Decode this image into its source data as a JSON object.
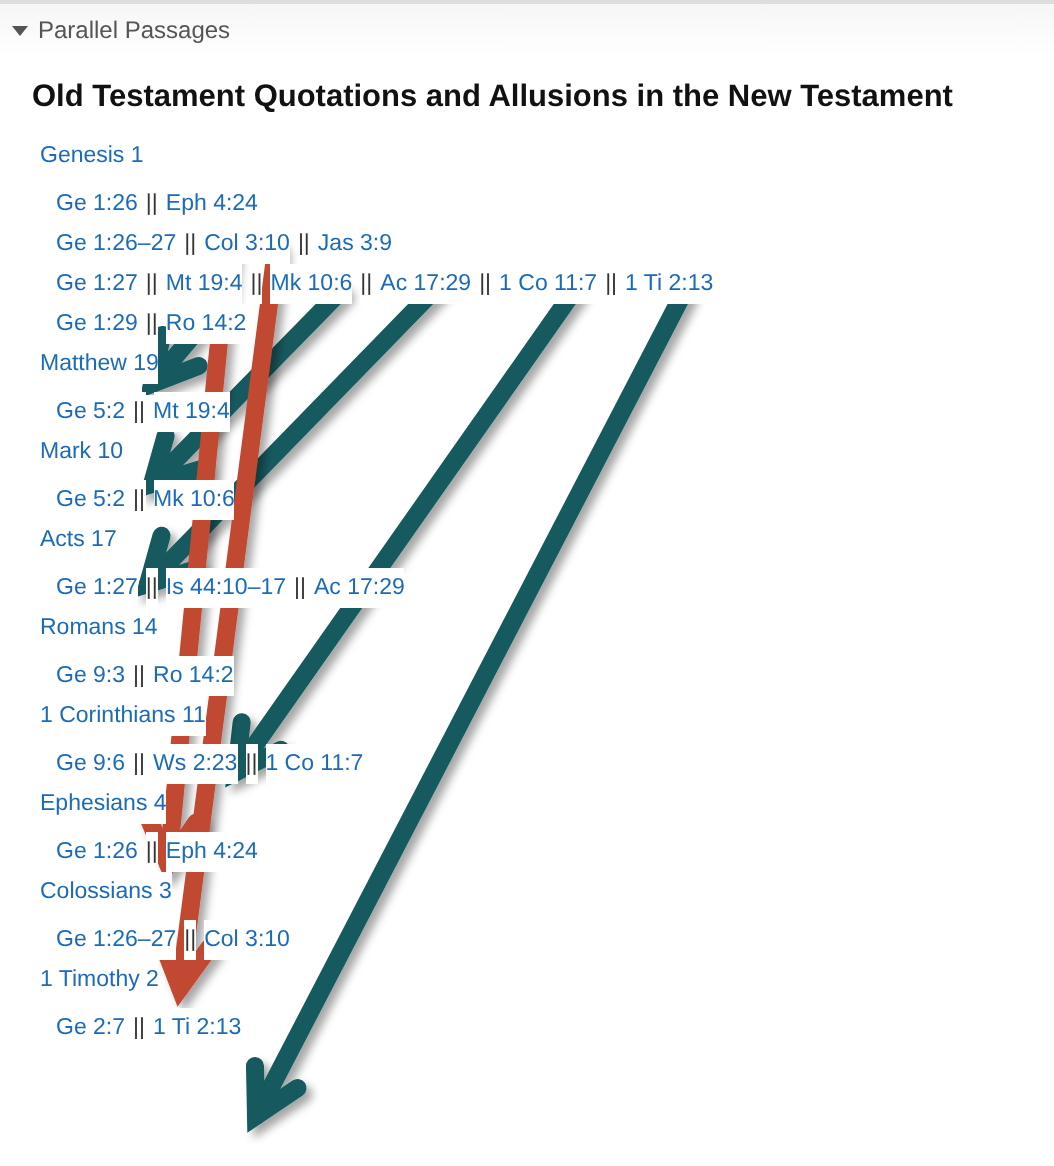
{
  "panel": {
    "title": "Parallel Passages",
    "expanded": true
  },
  "heading": "Old Testament Quotations and Allusions in the New Testament",
  "sections": [
    {
      "title": "Genesis 1",
      "passages": [
        {
          "refs": [
            "Ge 1:26",
            "Eph 4:24"
          ]
        },
        {
          "refs": [
            "Ge 1:26–27",
            "Col 3:10",
            "Jas 3:9"
          ]
        },
        {
          "refs": [
            "Ge 1:27",
            "Mt 19:4",
            "Mk 10:6",
            "Ac 17:29",
            "1 Co 11:7",
            "1 Ti 2:13"
          ]
        },
        {
          "refs": [
            "Ge 1:29",
            "Ro 14:2"
          ]
        }
      ]
    },
    {
      "title": "Matthew 19",
      "passages": [
        {
          "refs": [
            "Ge 5:2",
            "Mt 19:4"
          ]
        }
      ]
    },
    {
      "title": "Mark 10",
      "passages": [
        {
          "refs": [
            "Ge 5:2",
            "Mk 10:6"
          ]
        }
      ]
    },
    {
      "title": "Acts 17",
      "passages": [
        {
          "refs": [
            "Ge 1:27",
            "Is 44:10–17",
            "Ac 17:29"
          ]
        }
      ]
    },
    {
      "title": "Romans 14",
      "passages": [
        {
          "refs": [
            "Ge 9:3",
            "Ro 14:2"
          ]
        }
      ]
    },
    {
      "title": "1 Corinthians 11",
      "passages": [
        {
          "refs": [
            "Ge 9:6",
            "Ws 2:23",
            "1 Co 11:7"
          ]
        }
      ]
    },
    {
      "title": "Ephesians 4",
      "passages": [
        {
          "refs": [
            "Ge 1:26",
            "Eph 4:24"
          ]
        }
      ]
    },
    {
      "title": "Colossians 3",
      "passages": [
        {
          "refs": [
            "Ge 1:26–27",
            "Col 3:10"
          ]
        }
      ]
    },
    {
      "title": "1 Timothy 2",
      "passages": [
        {
          "refs": [
            "Ge 2:7",
            "1 Ti 2:13"
          ]
        }
      ]
    }
  ],
  "separator": "||"
}
